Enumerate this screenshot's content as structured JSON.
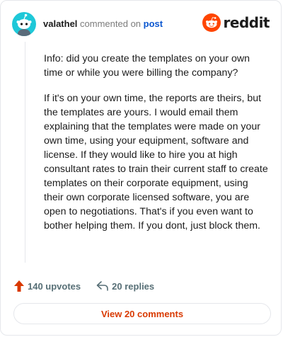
{
  "header": {
    "username": "valathel",
    "action": " commented on ",
    "post_link": "post",
    "logo_text": "reddit",
    "avatar_icon": "snoo-avatar-icon",
    "logo_icon": "reddit-logo-icon"
  },
  "comment": {
    "paragraphs": [
      "Info: did you create the templates on your own time or while you were billing the company?",
      "If it's on your own time, the reports are theirs, but the templates are yours. I would email them explaining that the templates were made on your own time, using your equipment, software and license. If they would like to hire you at high consultant rates to train their current staff to create templates on their corporate equipment, using their own corporate licensed software, you are open to negotiations. That's if you even want to bother helping them. If you dont, just block them."
    ]
  },
  "footer": {
    "upvotes": "140 upvotes",
    "replies": "20 replies",
    "view_comments": "View 20 comments",
    "upvote_icon": "upvote-arrow-icon",
    "reply_icon": "reply-arrow-icon"
  },
  "colors": {
    "avatar_bg": "#1fc8d8",
    "reddit_orange": "#ff4500",
    "link_blue": "#0b57d0",
    "button_text": "#d93900",
    "meta_gray": "#576f76"
  }
}
